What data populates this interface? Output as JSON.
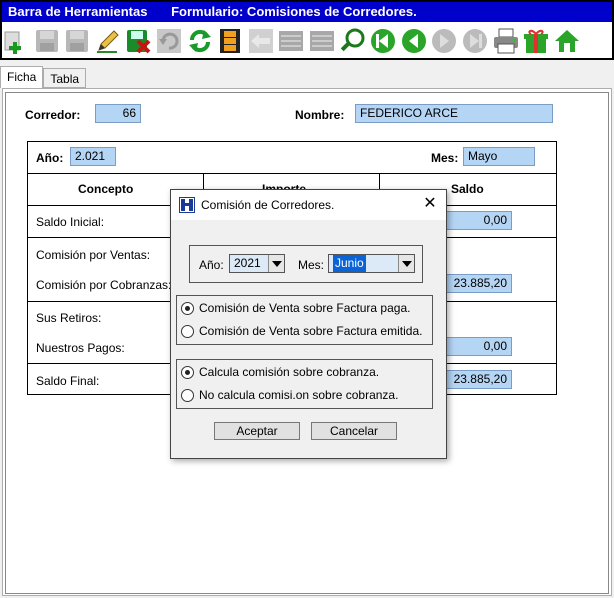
{
  "toolbar": {
    "title": "Barra de Herramientas",
    "form_title": "Formulario: Comisiones de Corredores.",
    "icons": [
      "add-icon",
      "save-icon",
      "save-all-icon",
      "edit-icon",
      "delete-icon",
      "undo-icon",
      "refresh-icon",
      "film-icon",
      "return-icon",
      "list-icon",
      "grid-icon",
      "search-icon",
      "first-record-icon",
      "previous-record-icon",
      "next-record-icon",
      "last-record-icon",
      "print-icon",
      "gift-icon",
      "home-icon"
    ]
  },
  "tabs": [
    "Ficha",
    "Tabla"
  ],
  "form": {
    "corredor_label": "Corredor:",
    "corredor_value": "66",
    "nombre_label": "Nombre:",
    "nombre_value": "FEDERICO ARCE",
    "anio_label": "Año:",
    "anio_value": "2.021",
    "mes_label": "Mes:",
    "mes_value": "Mayo",
    "headers": [
      "Concepto",
      "Importe",
      "Saldo"
    ],
    "rows": {
      "saldo_inicial": "Saldo Inicial:",
      "saldo_inicial_value": "0,00",
      "comision_ventas": "Comisión por Ventas:",
      "comision_cobranzas": "Comisión por Cobranzas:",
      "comision_cobranzas_value": "23.885,20",
      "sus_retiros": "Sus Retiros:",
      "nuestros_pagos": "Nuestros Pagos:",
      "nuestros_pagos_value": "0,00",
      "saldo_final": "Saldo Final:",
      "saldo_final_value": "23.885,20"
    }
  },
  "dialog": {
    "title": "Comisión de Corredores.",
    "close": "✕",
    "anio_label": "Año:",
    "anio_value": "2021",
    "mes_label": "Mes:",
    "mes_value": "Junio",
    "radio_paga": "Comisión de Venta sobre Factura paga.",
    "radio_emitida": "Comisión de Venta sobre Factura emitida.",
    "radio_calcula": "Calcula comisión sobre cobranza.",
    "radio_no_calcula": "No calcula comisi.on sobre cobranza.",
    "accept": "Aceptar",
    "cancel": "Cancelar"
  }
}
